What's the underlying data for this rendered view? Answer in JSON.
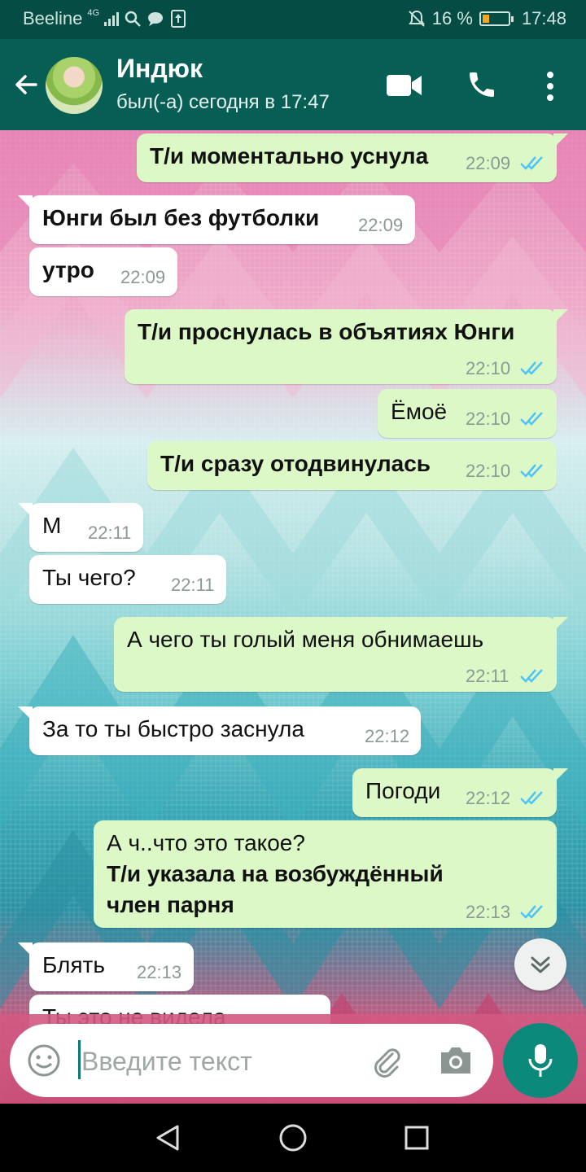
{
  "status_bar": {
    "carrier": "Beeline",
    "network": "4G",
    "battery": "16 %",
    "time": "17:48",
    "battery_level": 0.16
  },
  "header": {
    "name": "Индюк",
    "status": "был(-а) сегодня в 17:47"
  },
  "messages": [
    {
      "dir": "out",
      "text": "Т/и моментально уснула",
      "time": "22:09",
      "bold": true
    },
    {
      "dir": "in",
      "text": "Юнги был без футболки",
      "time": "22:09",
      "bold": true
    },
    {
      "dir": "in",
      "text": "утро",
      "time": "22:09",
      "bold": true
    },
    {
      "dir": "out",
      "text": "Т/и проснулась в объятиях Юнги",
      "time": "22:10",
      "bold": true
    },
    {
      "dir": "out",
      "text": "Ёмоё",
      "time": "22:10",
      "bold": false
    },
    {
      "dir": "out",
      "text": "Т/и сразу отодвинулась",
      "time": "22:10",
      "bold": true
    },
    {
      "dir": "in",
      "text": "М",
      "time": "22:11",
      "bold": false
    },
    {
      "dir": "in",
      "text": "Ты чего?",
      "time": "22:11",
      "bold": false
    },
    {
      "dir": "out",
      "text": "А чего ты голый меня обнимаешь",
      "time": "22:11",
      "bold": false
    },
    {
      "dir": "in",
      "text": "За то ты быстро заснула",
      "time": "22:12",
      "bold": false
    },
    {
      "dir": "out",
      "text": "Погоди",
      "time": "22:12",
      "bold": false
    },
    {
      "dir": "out",
      "line1": "А ч..что это такое?",
      "line2": "Т/и указала на возбуждённый",
      "line3": "член парня",
      "time": "22:13"
    },
    {
      "dir": "in",
      "text": "Блять",
      "time": "22:13",
      "bold": false
    },
    {
      "dir": "in",
      "text": "Ты это не видела",
      "time": "",
      "bold": false
    }
  ],
  "composer": {
    "placeholder": "Введите текст"
  },
  "colors": {
    "header": "#075e54",
    "status_bar": "#054d44",
    "outgoing": "#dcf8c6",
    "incoming": "#ffffff",
    "accent": "#0b8a7c",
    "ticks": "#4fc3f7"
  },
  "icons": [
    "back-arrow-icon",
    "video-call-icon",
    "phone-icon",
    "more-vert-icon",
    "emoji-icon",
    "attach-icon",
    "camera-icon",
    "mic-icon",
    "chevron-down-icon",
    "nav-back-icon",
    "nav-home-icon",
    "nav-recents-icon"
  ]
}
